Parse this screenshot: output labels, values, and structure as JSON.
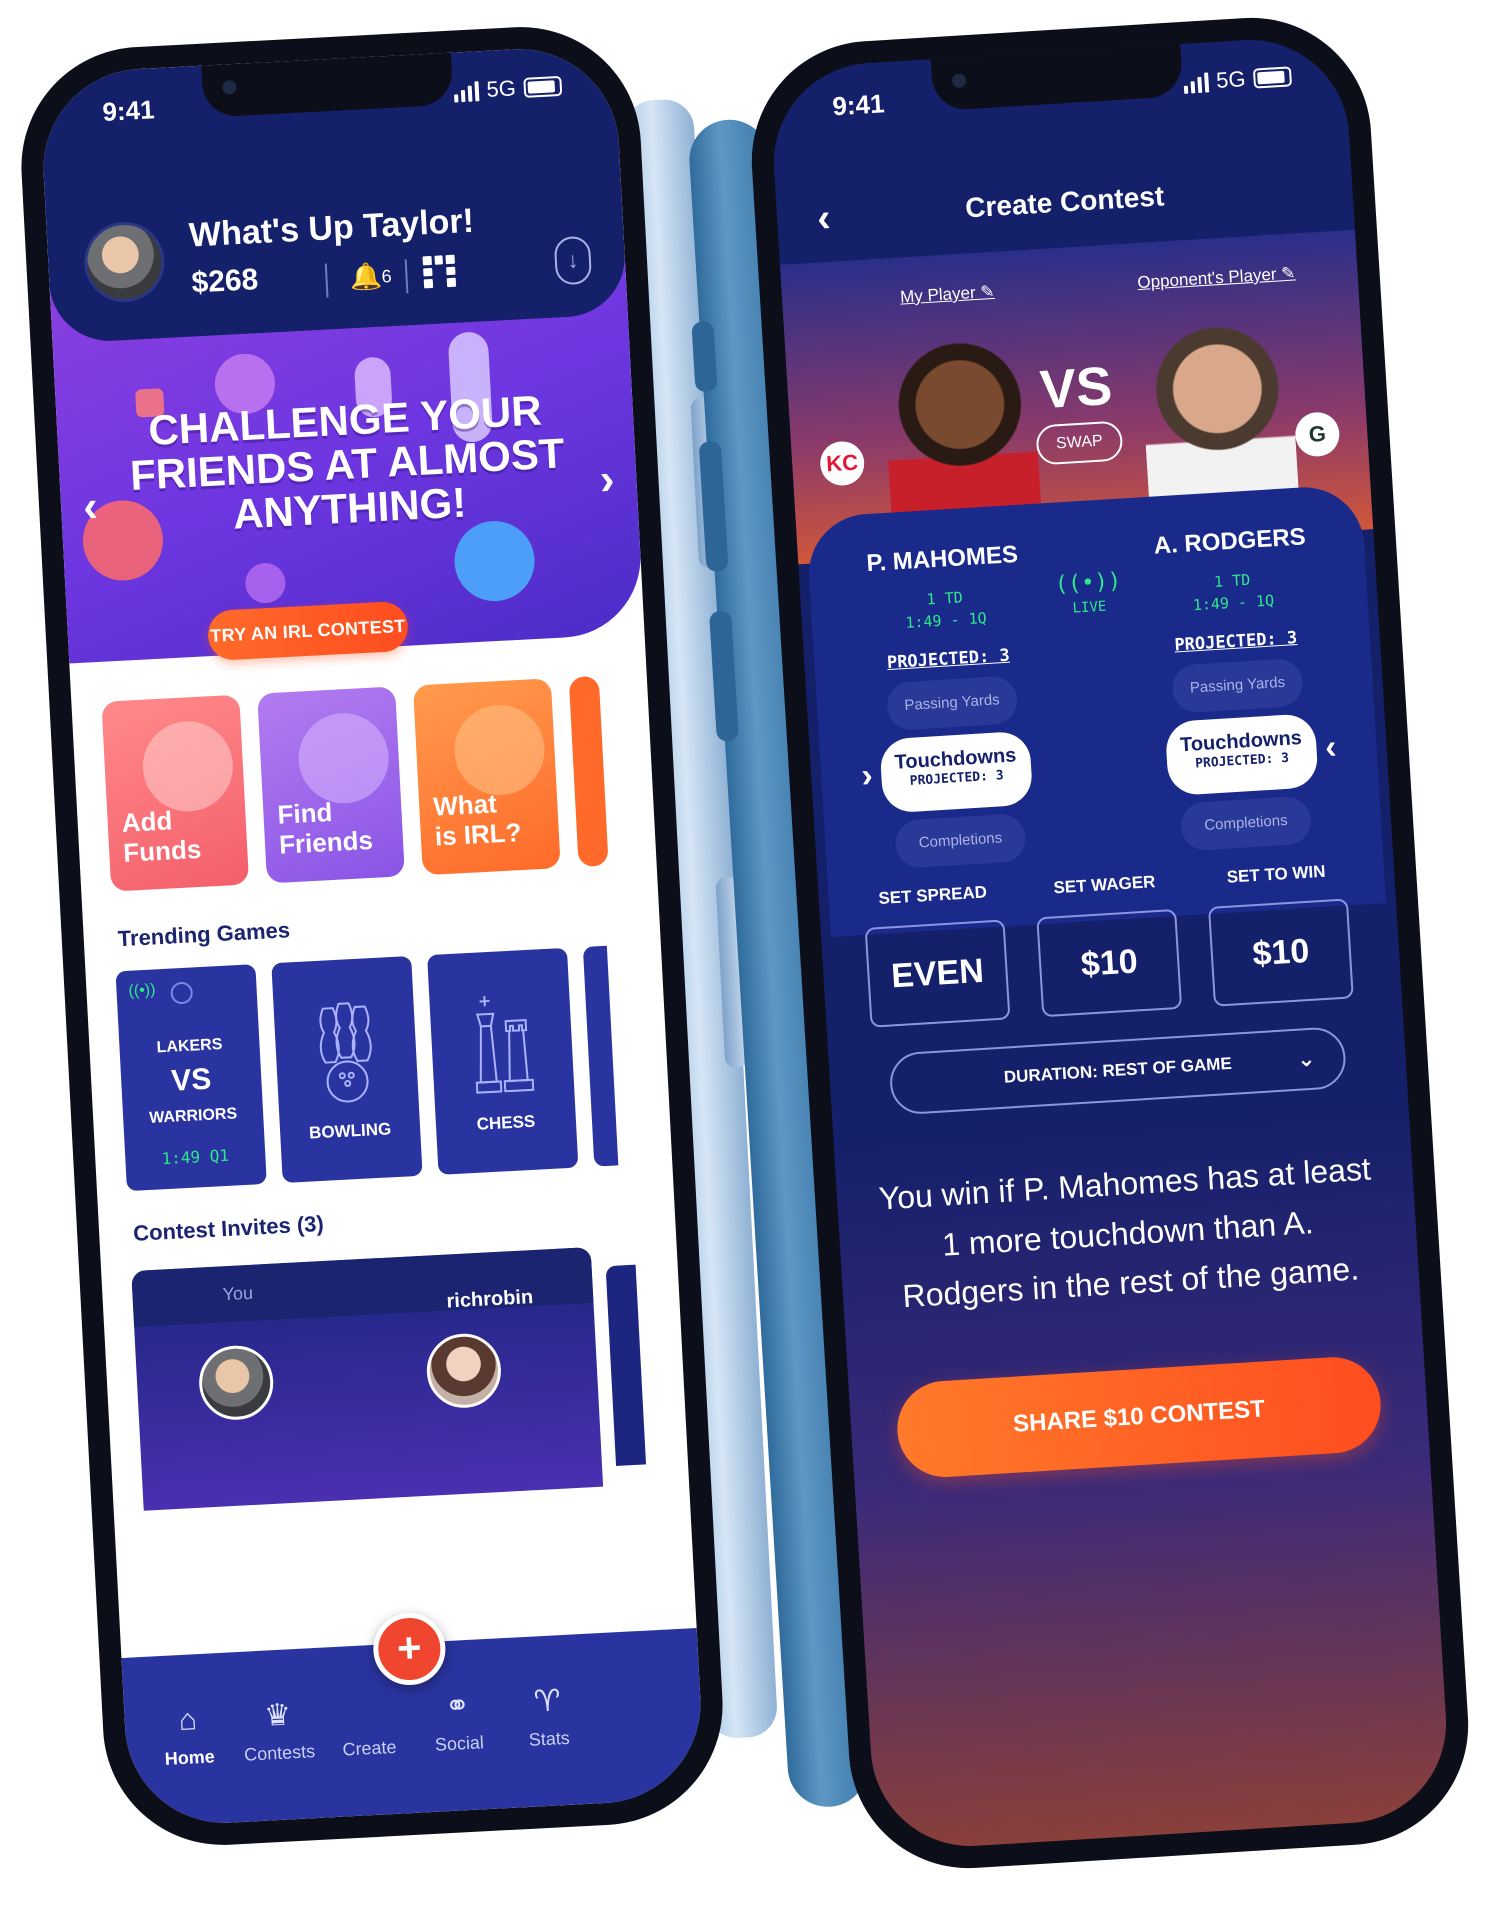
{
  "status": {
    "time": "9:41",
    "network": "5G"
  },
  "home": {
    "greeting": "What's Up Taylor!",
    "balance": "$268",
    "notifications_count": "6",
    "hero": {
      "lines": [
        "CHALLENGE YOUR",
        "FRIENDS AT ALMOST",
        "ANYTHING!"
      ],
      "cta": "TRY AN IRL CONTEST"
    },
    "quick_tiles": [
      {
        "label_line1": "Add",
        "label_line2": "Funds"
      },
      {
        "label_line1": "Find",
        "label_line2": "Friends"
      },
      {
        "label_line1": "What",
        "label_line2": "is IRL?"
      }
    ],
    "trending_title": "Trending Games",
    "games": {
      "live": {
        "team1": "LAKERS",
        "vs": "VS",
        "team2": "WARRIORS",
        "clock": "1:49 Q1"
      },
      "bowling": "BOWLING",
      "chess": "CHESS"
    },
    "invites_title": "Contest Invites (3)",
    "invite": {
      "you_label": "You",
      "opponent": "richrobin"
    },
    "tabs": [
      "Home",
      "Contests",
      "Create",
      "Social",
      "Stats"
    ]
  },
  "contest": {
    "title": "Create Contest",
    "my_player_label": "My Player",
    "opponent_player_label": "Opponent's Player",
    "vs": "VS",
    "swap": "SWAP",
    "player1": {
      "name": "P. MAHOMES",
      "stat_line1": "1 TD",
      "stat_line2": "1:49 - 1Q",
      "projected": "PROJECTED: 3",
      "team_logo": "KC"
    },
    "player2": {
      "name": "A. RODGERS",
      "stat_line1": "1 TD",
      "stat_line2": "1:49 - 1Q",
      "projected": "PROJECTED: 3",
      "team_logo": "G"
    },
    "live": "LIVE",
    "stat_options": {
      "above": "Passing Yards",
      "selected": "Touchdowns",
      "selected_projected": "PROJECTED: 3",
      "below": "Completions"
    },
    "set_spread": {
      "label": "SET SPREAD",
      "value": "EVEN"
    },
    "set_wager": {
      "label": "SET WAGER",
      "value": "$10"
    },
    "set_to_win": {
      "label": "SET TO WIN",
      "value": "$10"
    },
    "duration": "DURATION: REST OF GAME",
    "summary": "You win if P. Mahomes has at least 1 more touchdown than A. Rodgers in the rest of the game.",
    "share": "SHARE $10 CONTEST"
  },
  "colors": {
    "navy": "#15206a",
    "accent_orange": "#ff5a24",
    "live_green": "#2ee88a",
    "hero_purple": "#6d36e0"
  }
}
